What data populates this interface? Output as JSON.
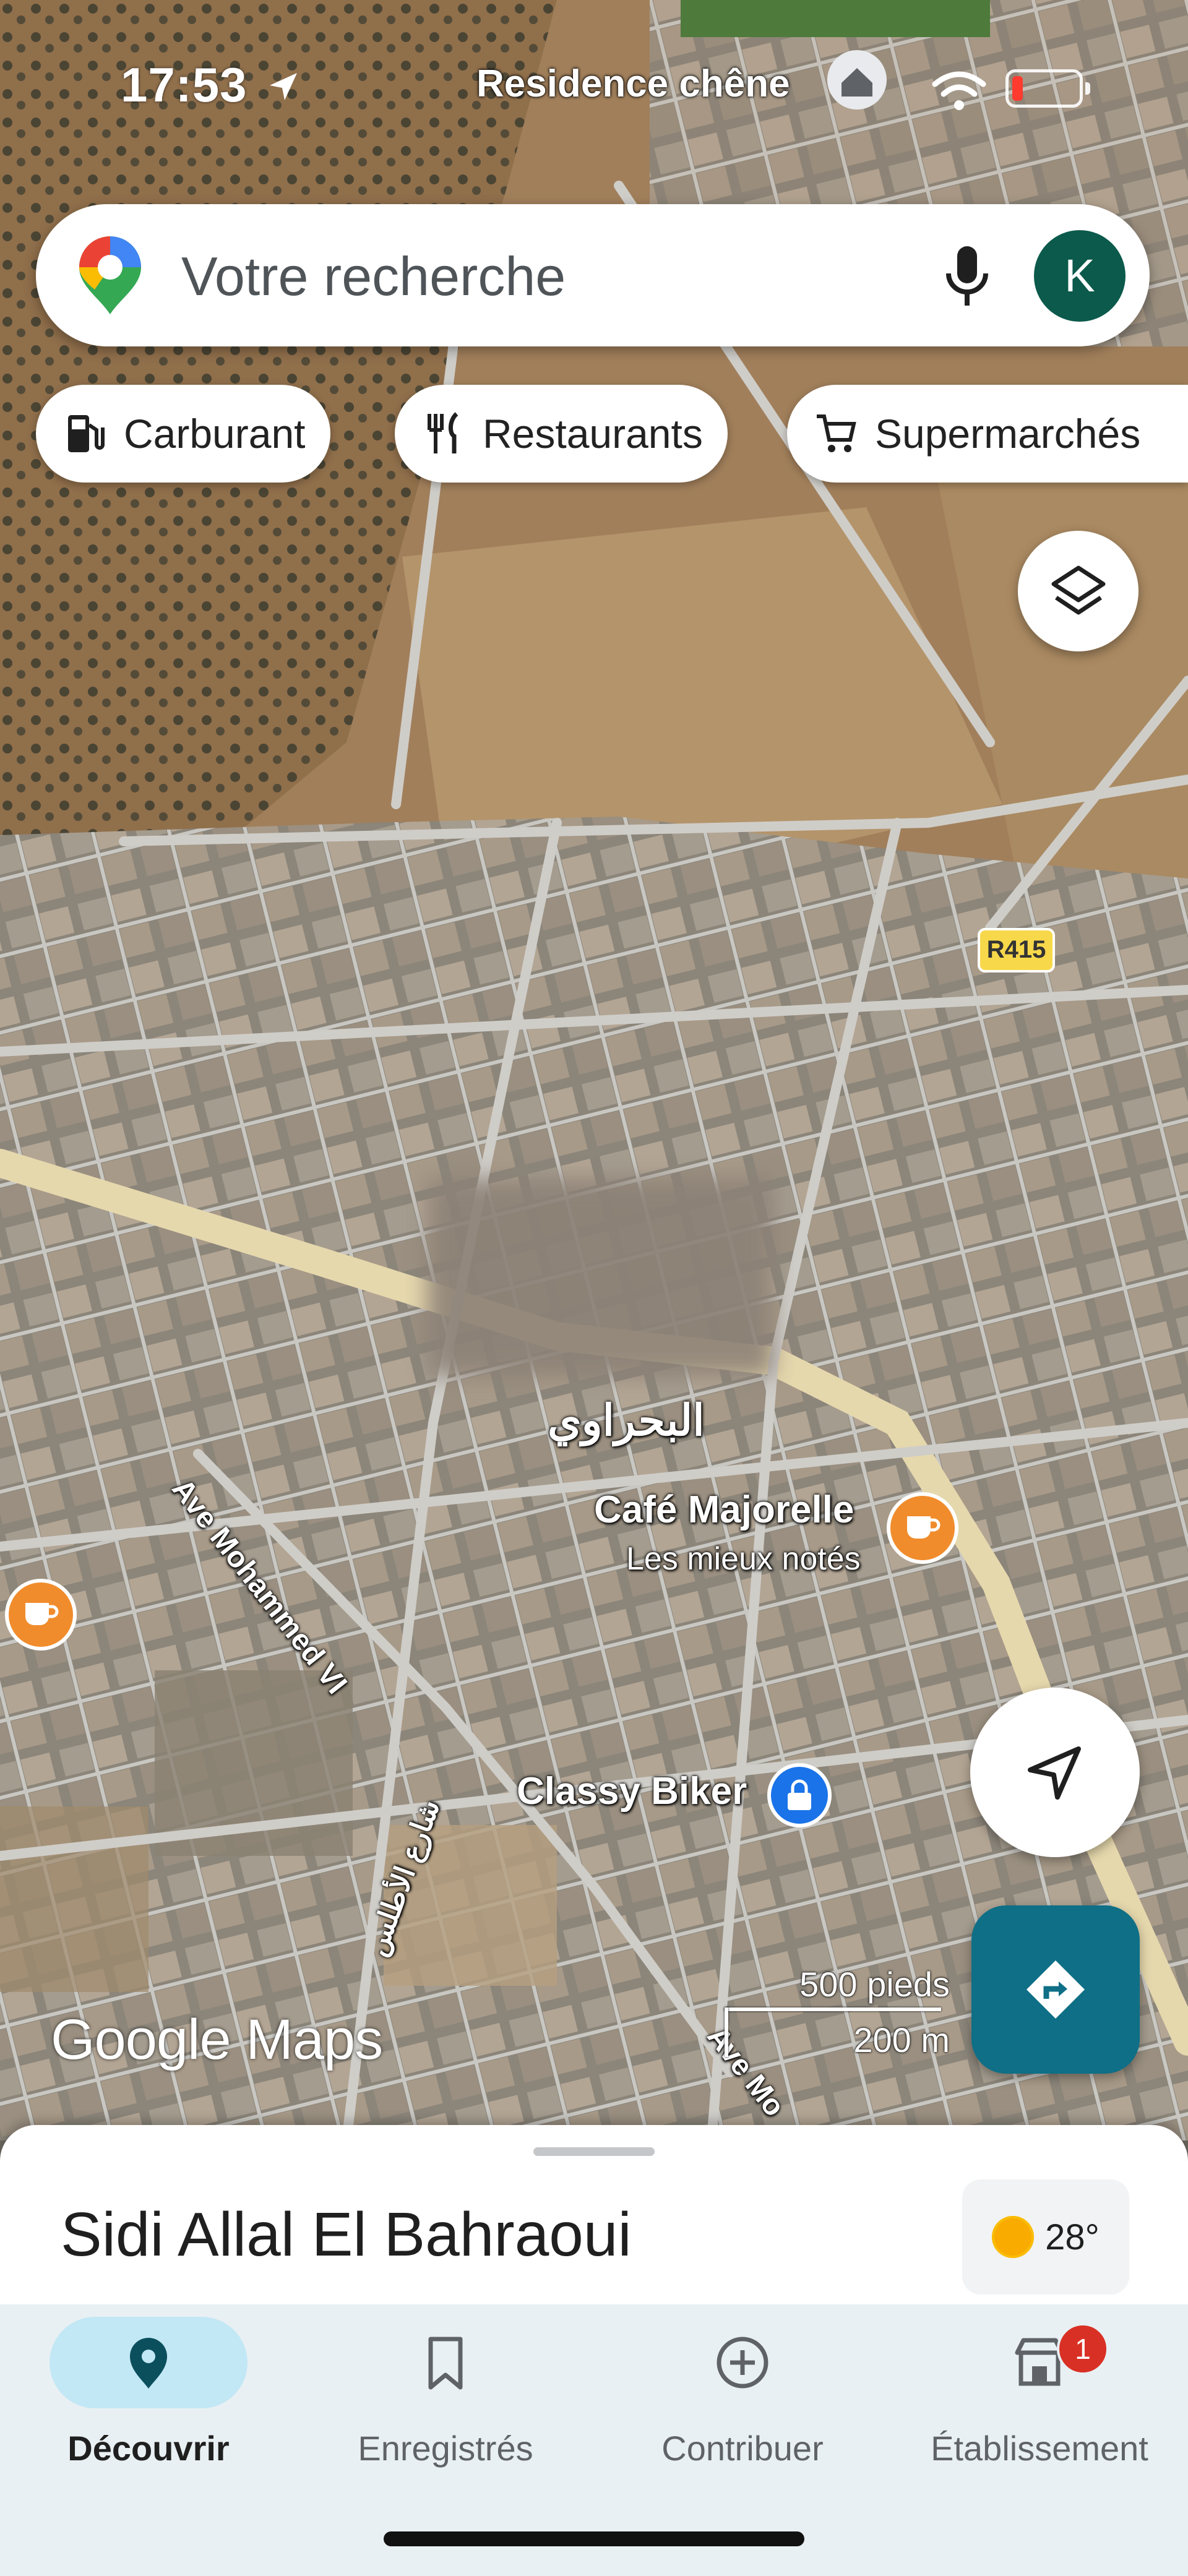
{
  "status_bar": {
    "time": "17:53",
    "location_name": "Residence chêne",
    "battery_level": 0.15
  },
  "search": {
    "placeholder": "Votre recherche",
    "avatar_letter": "K"
  },
  "chips": [
    {
      "label": "Carburant",
      "icon": "fuel-pump-icon"
    },
    {
      "label": "Restaurants",
      "icon": "fork-knife-icon"
    },
    {
      "label": "Supermarchés",
      "icon": "cart-icon"
    }
  ],
  "map": {
    "road_shield": "R415",
    "labels": {
      "arabic_area": "البحراوي",
      "cafe_name": "Café Majorelle",
      "cafe_subtitle": "Les mieux notés",
      "shop_name": "Classy Biker",
      "street_1": "Ave Mohammed VI",
      "street_2": "شارع الأطلس",
      "street_3": "Ave Mo"
    },
    "scale": {
      "imperial": "500 pieds",
      "metric": "200 m"
    },
    "branding": "Google Maps"
  },
  "sheet": {
    "place_name": "Sidi Allal El Bahraoui",
    "weather_temp": "28°"
  },
  "nav": [
    {
      "label": "Découvrir",
      "icon": "map-pin-icon",
      "active": true
    },
    {
      "label": "Enregistrés",
      "icon": "bookmark-icon",
      "active": false
    },
    {
      "label": "Contribuer",
      "icon": "plus-circle-icon",
      "active": false
    },
    {
      "label": "Établissement",
      "icon": "store-icon",
      "active": false,
      "badge": "1"
    }
  ],
  "colors": {
    "accent": "#0e6f86",
    "avatar": "#0b5a4c",
    "nav_active_pill": "#c2e7f5",
    "badge": "#d93025",
    "poi_orange": "#f08c2c"
  }
}
